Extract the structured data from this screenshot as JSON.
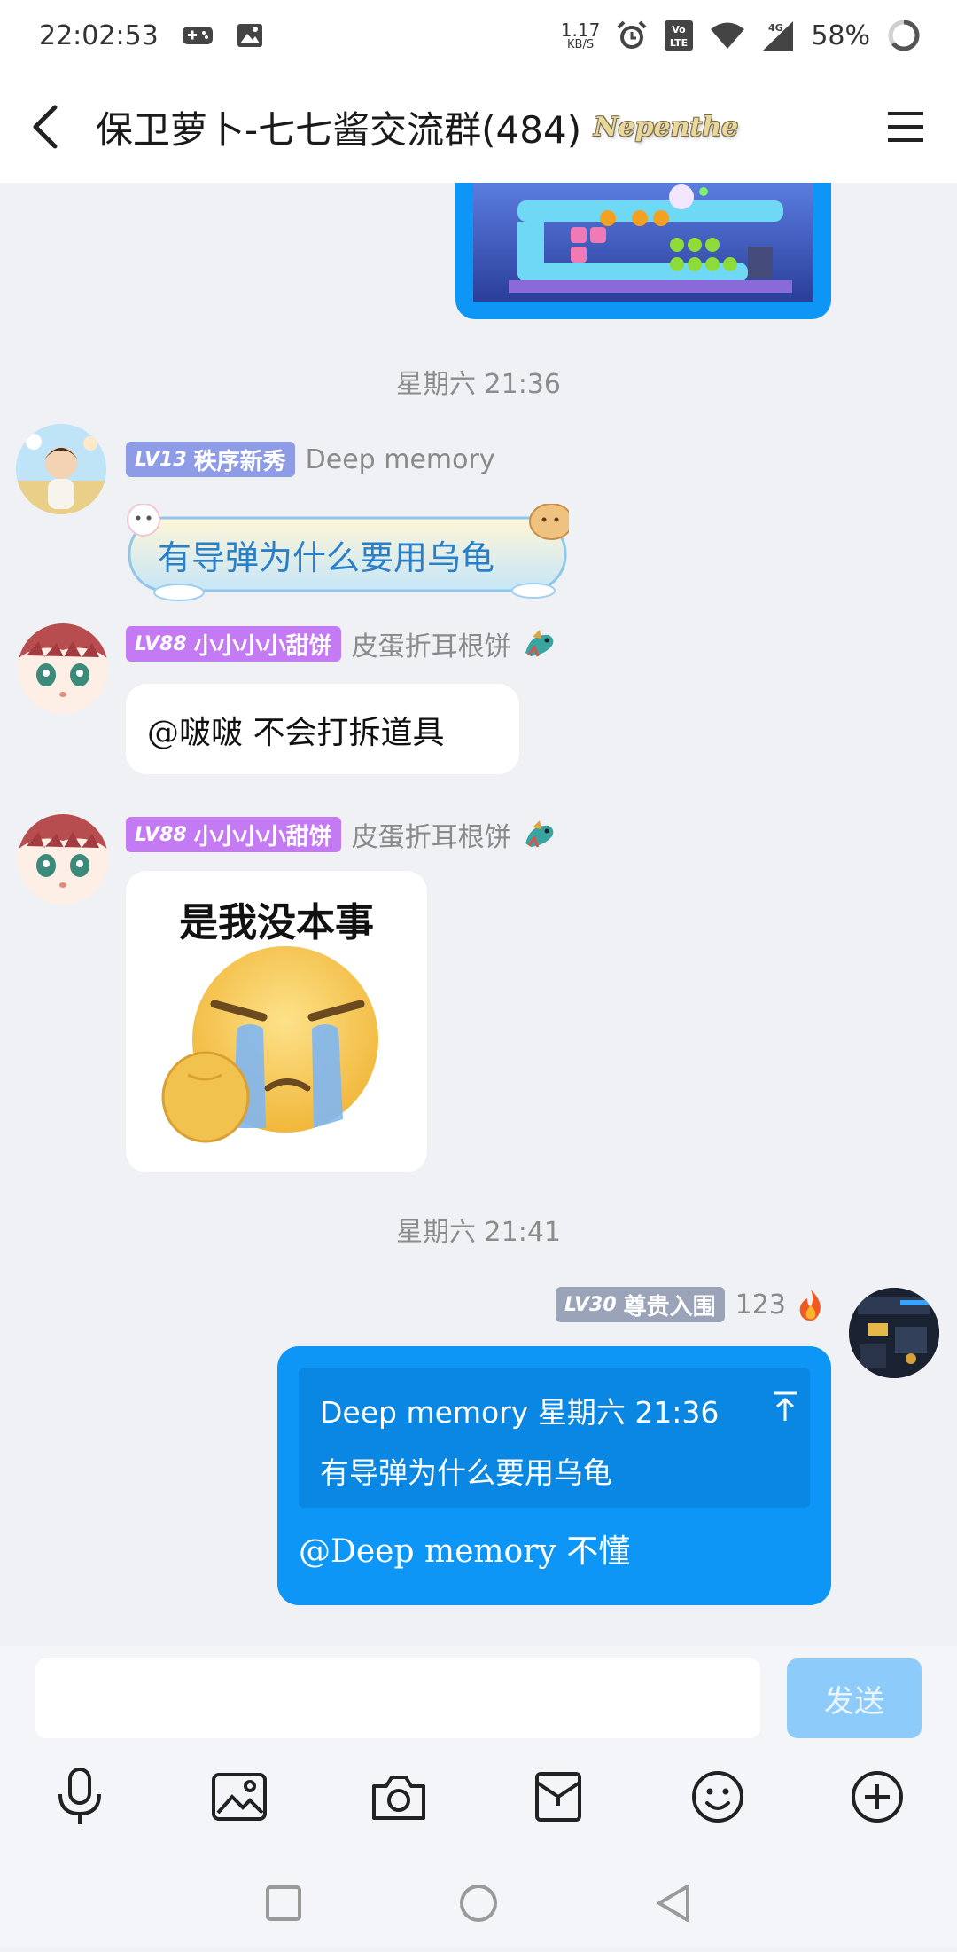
{
  "status_bar": {
    "time": "22:02:53",
    "net_speed": "1.17",
    "net_unit": "KB/S",
    "volte": "Vo LTE",
    "signal_gen": "4G",
    "battery": "58%"
  },
  "header": {
    "title": "保卫萝卜-七七酱交流群(484)",
    "badge": "Nepenthe"
  },
  "messages": {
    "ts1": "星期六 21:36",
    "ts2": "星期六 21:41",
    "m1": {
      "level": "LV13",
      "title": "秩序新秀",
      "nick": "Deep memory",
      "text": "有导弹为什么要用乌龟",
      "level_color": "#8e9be6"
    },
    "m2": {
      "level": "LV88",
      "title": "小小小小甜饼",
      "nick": "皮蛋折耳根饼",
      "text": "@啵啵 不会打拆道具",
      "level_color": "#c37af2"
    },
    "m3": {
      "level": "LV88",
      "title": "小小小小甜饼",
      "nick": "皮蛋折耳根饼",
      "sticker_caption": "是我没本事",
      "level_color": "#c37af2"
    },
    "m4": {
      "level": "LV30",
      "title": "尊贵入围",
      "nick": "123",
      "quote_header": "Deep memory 星期六 21:36",
      "quote_text": "有导弹为什么要用乌龟",
      "text": "@Deep memory 不懂",
      "level_color": "#9aa3b8",
      "bubble_color": "#0d96f6"
    }
  },
  "input": {
    "placeholder": "",
    "send_label": "发送"
  },
  "toolbar": [
    "mic-icon",
    "image-icon",
    "camera-icon",
    "red-packet-icon",
    "emoji-icon",
    "plus-icon"
  ],
  "colors": {
    "accent": "#0d96f6",
    "send_disabled": "#8dcbfa"
  }
}
